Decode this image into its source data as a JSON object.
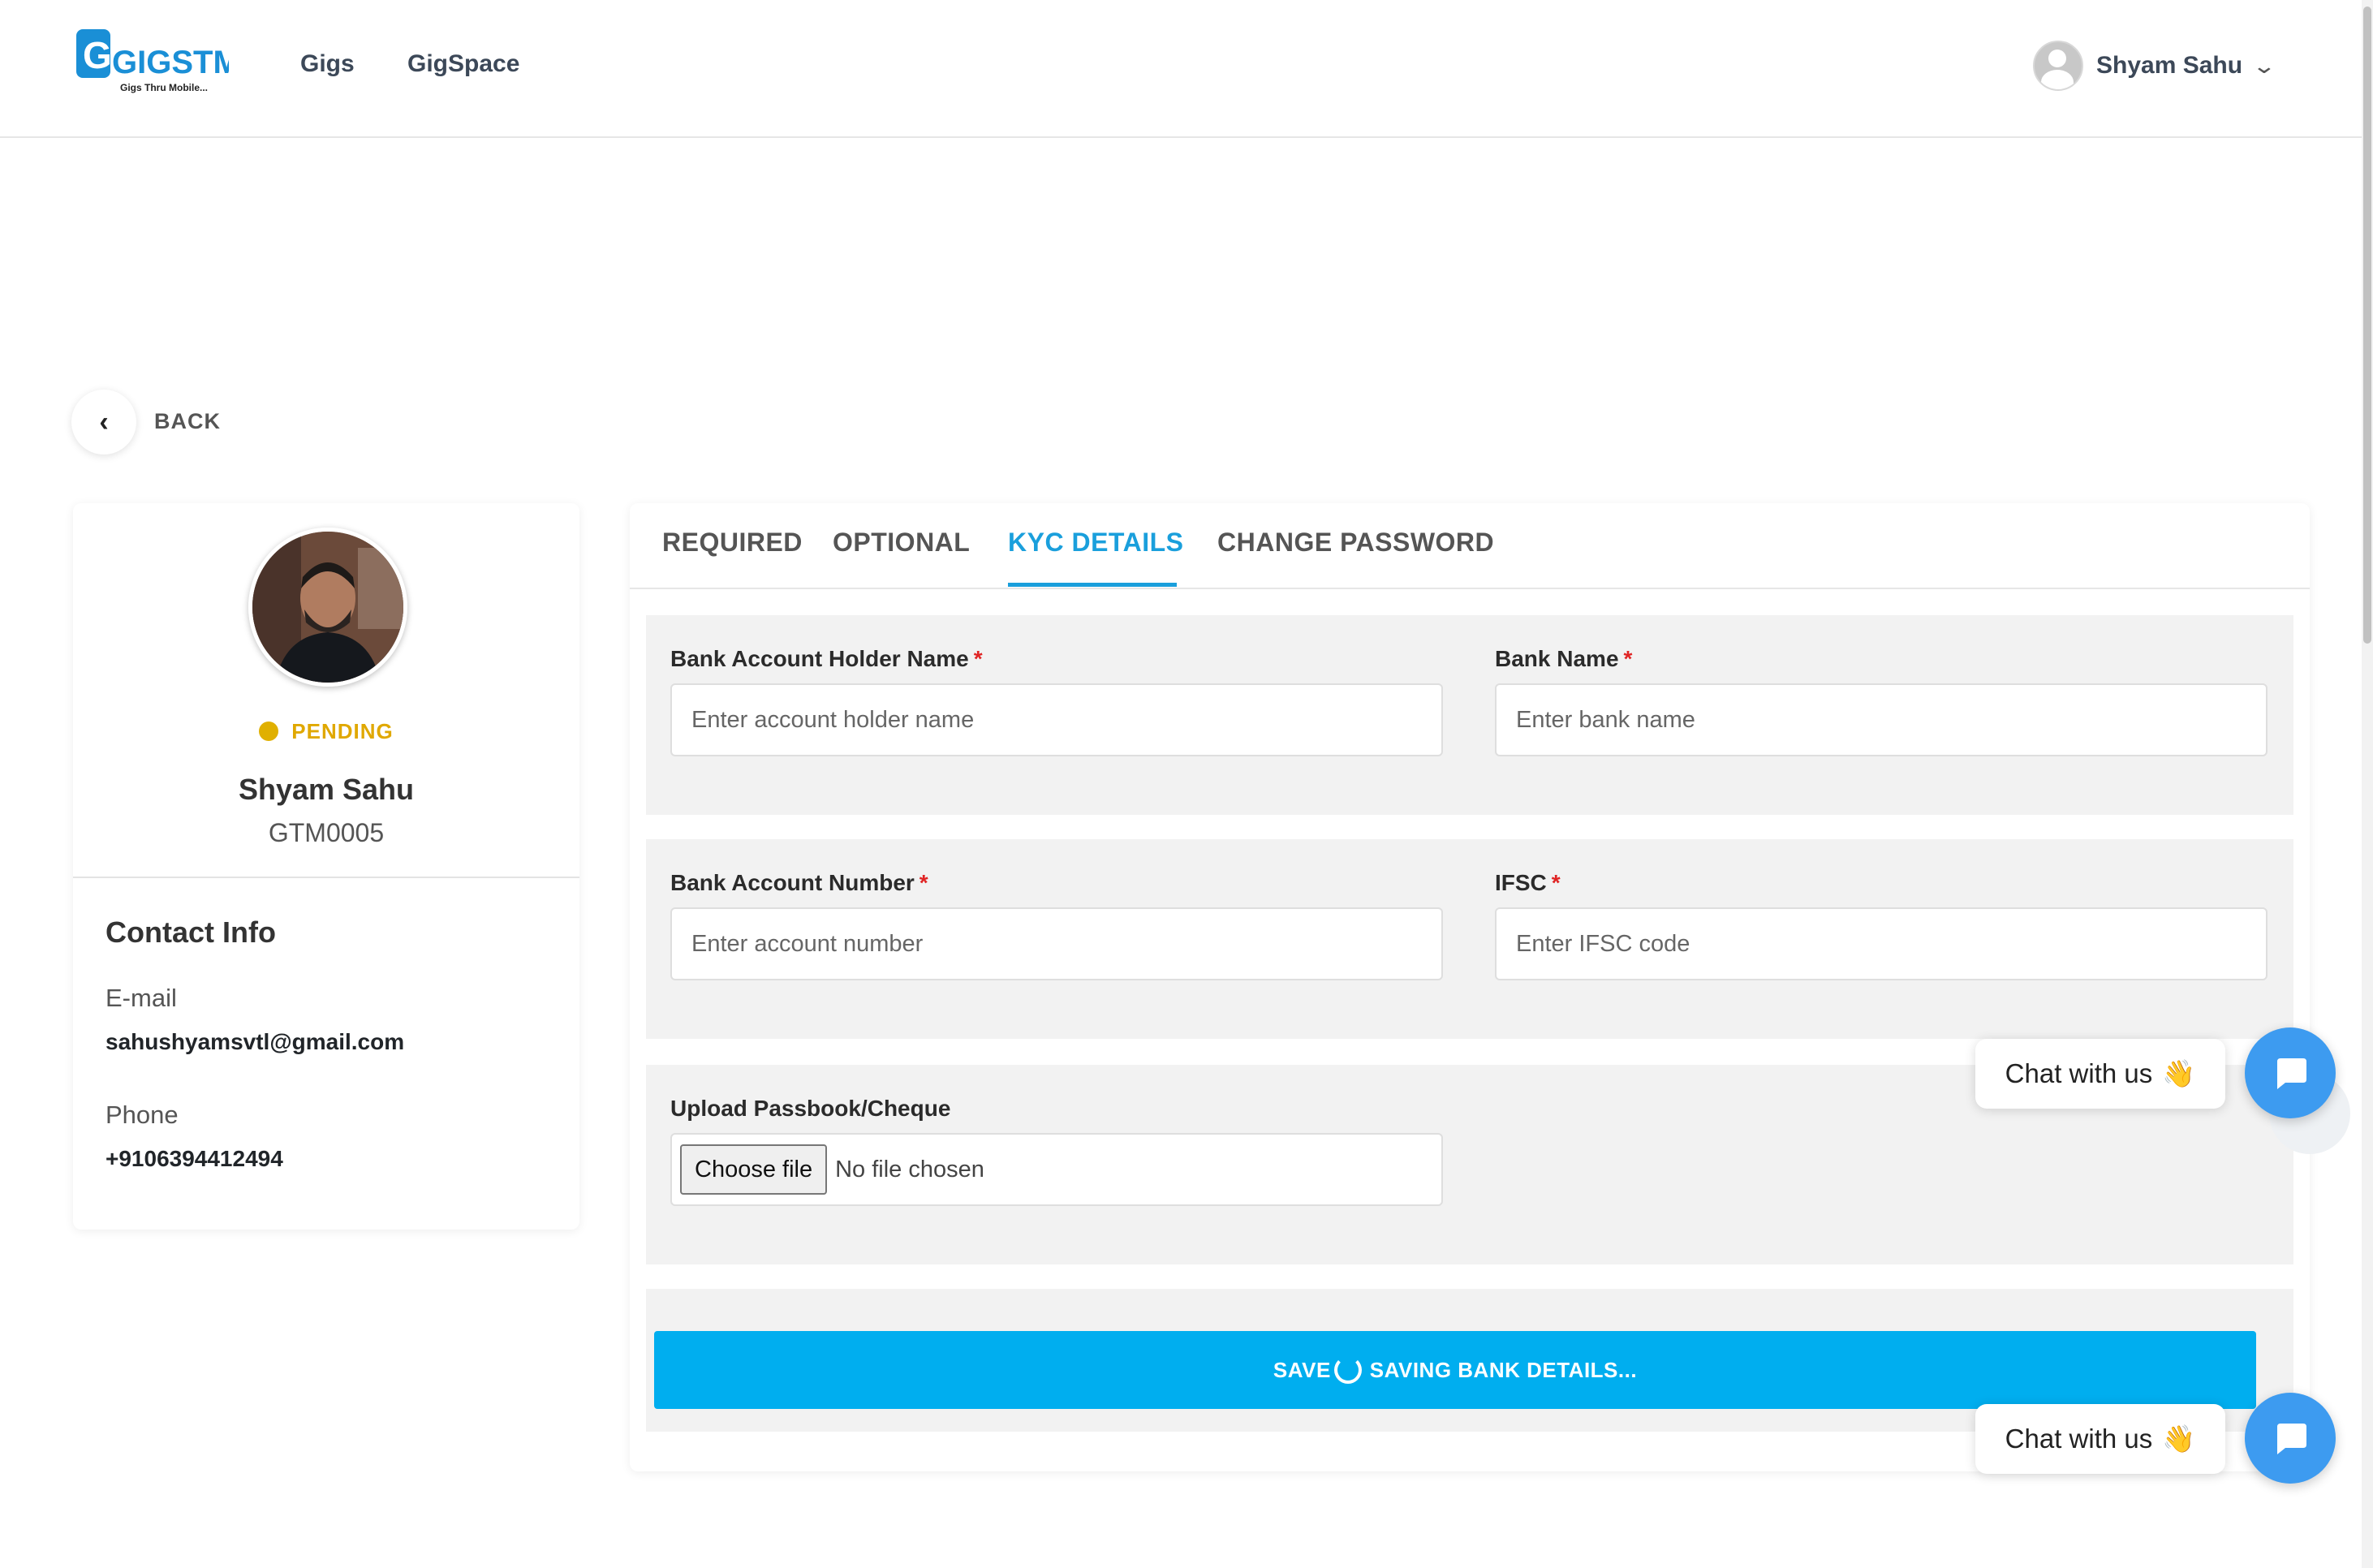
{
  "header": {
    "logo_text": "GIGSTM",
    "logo_tagline": "Gigs Thru Mobile...",
    "nav": [
      "Gigs",
      "GigSpace"
    ],
    "user_name": "Shyam Sahu"
  },
  "back": {
    "label": "BACK"
  },
  "profile": {
    "status": "PENDING",
    "name": "Shyam Sahu",
    "id": "GTM0005",
    "contact_title": "Contact Info",
    "email_label": "E-mail",
    "email": "sahushyamsvtl@gmail.com",
    "phone_label": "Phone",
    "phone": "+9106394412494"
  },
  "tabs": [
    "REQUIRED",
    "OPTIONAL",
    "KYC DETAILS",
    "CHANGE PASSWORD"
  ],
  "active_tab": "KYC DETAILS",
  "form": {
    "holder_label": "Bank Account Holder Name",
    "holder_placeholder": "Enter account holder name",
    "bank_label": "Bank Name",
    "bank_placeholder": "Enter bank name",
    "account_label": "Bank Account Number",
    "account_placeholder": "Enter account number",
    "ifsc_label": "IFSC",
    "ifsc_placeholder": "Enter IFSC code",
    "required_mark": "*",
    "upload_label": "Upload Passbook/Cheque",
    "file_button": "Choose file",
    "file_status": "No file chosen",
    "save_label": "SAVE",
    "saving_label": "SAVING BANK DETAILS..."
  },
  "chat": {
    "label": "Chat with us",
    "emoji": "👋"
  },
  "colors": {
    "accent": "#1a9fdc",
    "save_button": "#00aeef",
    "pending": "#e0a800",
    "chat": "#3d9bf0"
  }
}
